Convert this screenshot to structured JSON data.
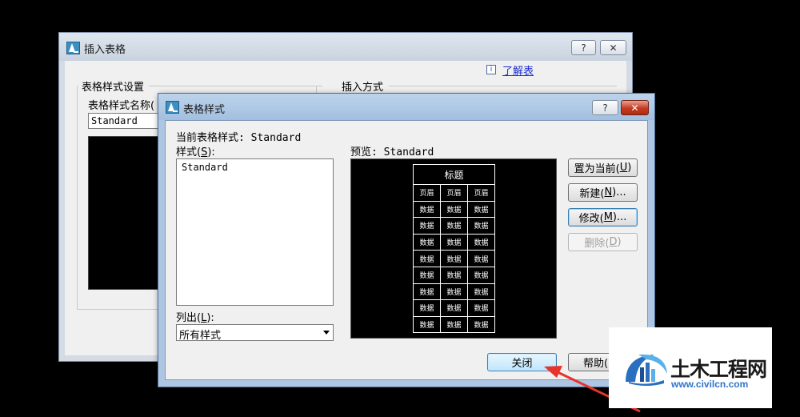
{
  "insert_dialog": {
    "title": "插入表格",
    "help_label": "?",
    "close_label": "✕",
    "learn_link": "了解表",
    "style_group_label": "表格样式设置",
    "style_name_label": "表格样式名称(",
    "style_name_value": "Standard",
    "insert_method_label": "插入方式"
  },
  "table_style_dialog": {
    "title": "表格样式",
    "help_label": "?",
    "close_label": "✕",
    "current_style_label": "当前表格样式: Standard",
    "styles_label": "样式(",
    "styles_mnemonic": "S",
    "styles_label_end": "):",
    "styles": [
      "Standard"
    ],
    "list_label": "列出(",
    "list_mnemonic": "L",
    "list_label_end": "):",
    "list_value": "所有样式",
    "preview_label": "预览: Standard",
    "preview": {
      "title": "标题",
      "header": [
        "页眉",
        "页眉",
        "页眉"
      ],
      "cell": "数据",
      "row_count": 8
    },
    "buttons": {
      "set_current": {
        "text": "置为当前(",
        "mnemonic": "U",
        "end": ")"
      },
      "new": {
        "text": "新建(",
        "mnemonic": "N",
        "end": ")..."
      },
      "modify": {
        "text": "修改(",
        "mnemonic": "M",
        "end": ")..."
      },
      "delete": {
        "text": "删除(",
        "mnemonic": "D",
        "end": ")"
      },
      "close": "关闭",
      "help": "帮助("
    }
  },
  "watermark": {
    "name": "土木工程网",
    "url": "www.civilcn.com"
  },
  "colors": {
    "background": "#000000",
    "link": "#1b2fd0",
    "annotation_arrow": "#e8332a",
    "watermark_url": "#2f74c8"
  }
}
